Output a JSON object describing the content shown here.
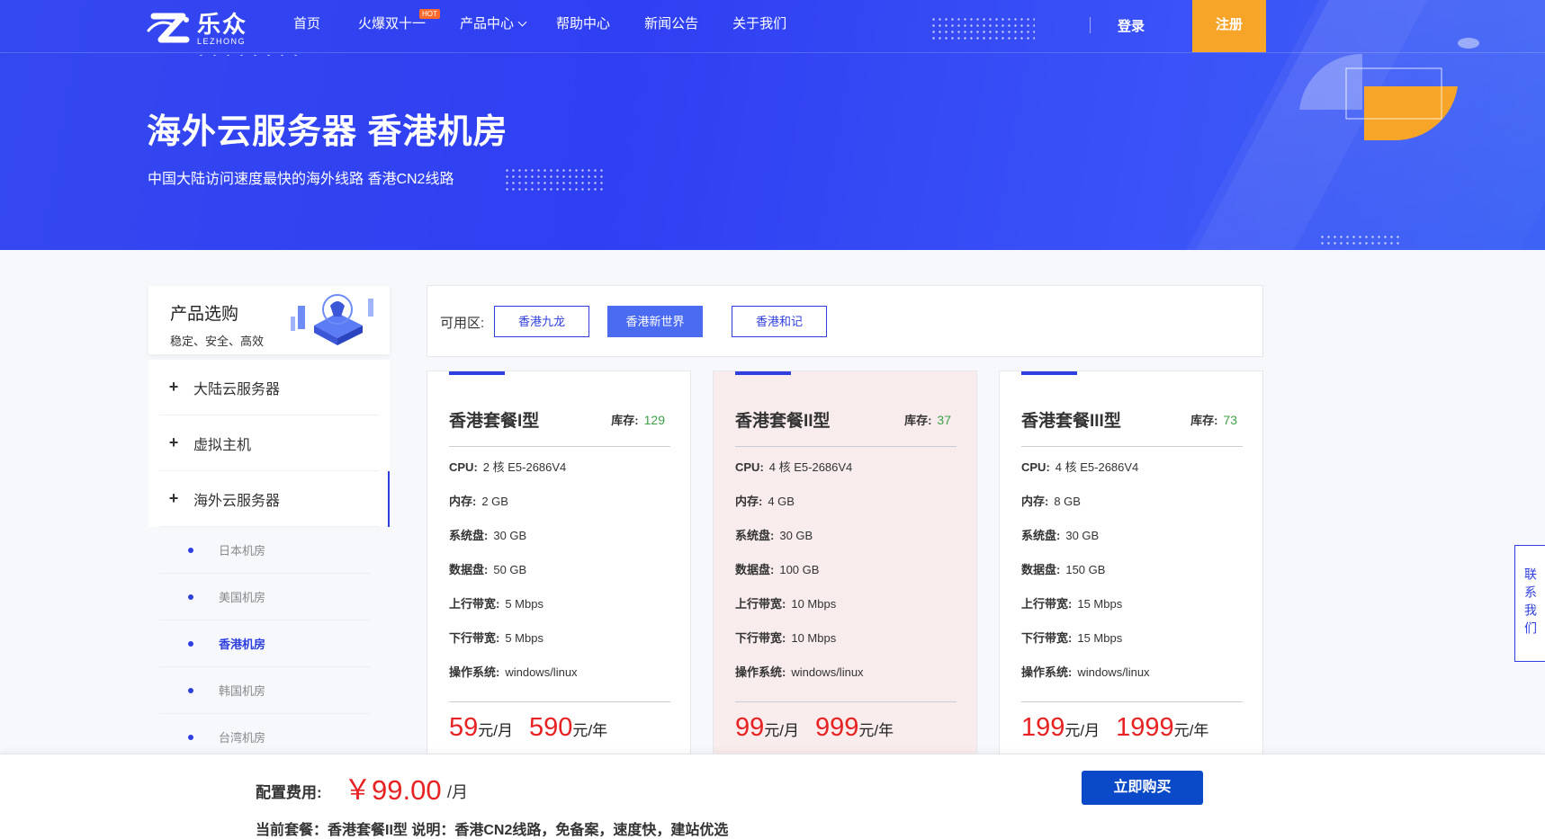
{
  "brand": {
    "name_cn": "乐众",
    "name_en": "LEZHONG"
  },
  "nav": {
    "items": [
      {
        "label": "首页"
      },
      {
        "label": "火爆双十一",
        "badge": "HOT"
      },
      {
        "label": "产品中心",
        "has_dropdown": true
      },
      {
        "label": "帮助中心"
      },
      {
        "label": "新闻公告"
      },
      {
        "label": "关于我们"
      }
    ],
    "login": "登录",
    "register": "注册"
  },
  "hero": {
    "title": "海外云服务器 香港机房",
    "subtitle": "中国大陆访问速度最快的海外线路 香港CN2线路"
  },
  "sidebar": {
    "title": "产品选购",
    "desc": "稳定、安全、高效",
    "categories": [
      {
        "label": "大陆云服务器"
      },
      {
        "label": "虚拟主机"
      },
      {
        "label": "海外云服务器",
        "active": true
      }
    ],
    "subitems": [
      {
        "label": "日本机房"
      },
      {
        "label": "美国机房"
      },
      {
        "label": "香港机房",
        "active": true
      },
      {
        "label": "韩国机房"
      },
      {
        "label": "台湾机房"
      }
    ]
  },
  "zones": {
    "label": "可用区:",
    "options": [
      {
        "label": "香港九龙"
      },
      {
        "label": "香港新世界",
        "active": true
      },
      {
        "label": "香港和记"
      }
    ]
  },
  "plans": [
    {
      "name": "香港套餐I型",
      "stock_label": "库存:",
      "stock": "129",
      "specs": [
        {
          "k": "CPU:",
          "v": "2 核 E5-2686V4"
        },
        {
          "k": "内存:",
          "v": "2 GB"
        },
        {
          "k": "系统盘:",
          "v": "30 GB"
        },
        {
          "k": "数据盘:",
          "v": "50 GB"
        },
        {
          "k": "上行带宽:",
          "v": "5 Mbps"
        },
        {
          "k": "下行带宽:",
          "v": "5 Mbps"
        },
        {
          "k": "操作系统:",
          "v": "windows/linux"
        }
      ],
      "price_month": "59",
      "month_unit": "元/月",
      "price_year": "590",
      "year_unit": "元/年"
    },
    {
      "name": "香港套餐II型",
      "stock_label": "库存:",
      "stock": "37",
      "selected": true,
      "specs": [
        {
          "k": "CPU:",
          "v": "4 核 E5-2686V4"
        },
        {
          "k": "内存:",
          "v": "4 GB"
        },
        {
          "k": "系统盘:",
          "v": "30 GB"
        },
        {
          "k": "数据盘:",
          "v": "100 GB"
        },
        {
          "k": "上行带宽:",
          "v": "10 Mbps"
        },
        {
          "k": "下行带宽:",
          "v": "10 Mbps"
        },
        {
          "k": "操作系统:",
          "v": "windows/linux"
        }
      ],
      "price_month": "99",
      "month_unit": "元/月",
      "price_year": "999",
      "year_unit": "元/年"
    },
    {
      "name": "香港套餐III型",
      "stock_label": "库存:",
      "stock": "73",
      "specs": [
        {
          "k": "CPU:",
          "v": "4 核 E5-2686V4"
        },
        {
          "k": "内存:",
          "v": "8 GB"
        },
        {
          "k": "系统盘:",
          "v": "30 GB"
        },
        {
          "k": "数据盘:",
          "v": "150 GB"
        },
        {
          "k": "上行带宽:",
          "v": "15 Mbps"
        },
        {
          "k": "下行带宽:",
          "v": "15 Mbps"
        },
        {
          "k": "操作系统:",
          "v": "windows/linux"
        }
      ],
      "price_month": "199",
      "month_unit": "元/月",
      "price_year": "1999",
      "year_unit": "元/年"
    }
  ],
  "contact": "联系我们",
  "footer": {
    "cost_label": "配置费用:",
    "cost_value": "￥99.00",
    "cost_unit": "/月",
    "current_plan": "当前套餐：香港套餐II型 说明：香港CN2线路，免备案，速度快，建站优选",
    "buy_label": "立即购买"
  },
  "colors": {
    "hero_blue": "#3448f0",
    "accent": "#2e3fe0",
    "register": "#f7a529",
    "price_red": "#e82222",
    "buy_button": "#0a49c8",
    "stock_green": "#3fa04a"
  }
}
